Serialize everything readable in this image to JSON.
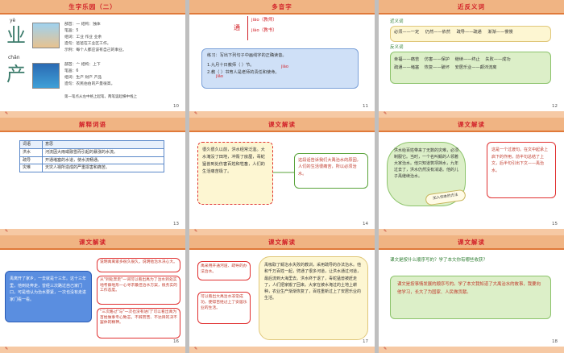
{
  "slides": [
    {
      "page": "10",
      "title": "生字乐园（二）",
      "char1": {
        "pinyin": "yè",
        "char": "业"
      },
      "char2": {
        "pinyin": "chǎn",
        "char": "产"
      },
      "lines": [
        "部首：一  结构：独体",
        "笔画：5",
        "组词：工业  作业  业余",
        "造句：爸爸在工业区工作。",
        "示例：每个人都应该有自己的事业。"
      ],
      "lines2": [
        "部首：亠  结构：上下",
        "笔画：6",
        "组词：生产  财产  产品",
        "造句：农民伯伯的产量很高。"
      ],
      "note": "第一笔点从左中格上起笔，两笔竖起横中线上"
    },
    {
      "page": "11",
      "title": "多音字",
      "hanzi": "通",
      "readings": [
        "jiāo（教师）",
        "jiào（教书）"
      ],
      "task": "练习：写出下列句子中画线字的正确读音。",
      "q1": "1.九月十日教师（   ）节。",
      "q2": "2.教（     ）书育人是老师的责任和使命。",
      "ans1": "jiào",
      "ans2": "jiāo"
    },
    {
      "page": "12",
      "title": "近反义词",
      "syn_label": "近义词",
      "syn": [
        "必须——一定",
        "仍然——依然",
        "疏导——疏通",
        "渐渐——慢慢"
      ],
      "ant_label": "反义词",
      "ant": [
        "幸福——痛苦",
        "仿害——保护",
        "继续——终止",
        "失败——成功",
        "疏通——堵塞",
        "恢复——破坏",
        "安居乐业——颠沛流离"
      ]
    },
    {
      "page": "13",
      "title": "解释词语",
      "head": [
        "词语",
        "意思"
      ],
      "rows": [
        [
          "洪水",
          "河流因大雨或融雪而引起的暴涨的水流。"
        ],
        [
          "疏导",
          "开通堵塞的水道，使水流畅通。"
        ],
        [
          "灾难",
          "天灾人祸所造成的严重损害和痛苦。"
        ]
      ]
    },
    {
      "page": "14",
      "title": "课文解读",
      "passage": "很久很久以前，洪水经常泛滥。大水淹没了田地，冲毁了房屋，毒蛇猛兽到处伤害百姓和牲畜，人们的生活痛苦极了。",
      "comment": "这段话告诉我们大禹治水的原因，人们的生活很痛苦，所以必须治水。"
    },
    {
      "page": "15",
      "title": "课文解读",
      "passage": "洪水给百姓带来了无数的灾难，必须制服它。当时，一个名叫鲧的人领着大家治水。他只知道筑坝挡水，九年过去了，洪水仍然没有消退。他的儿子禹继续治水。",
      "note": "这是一个过渡句。在文中起承上启下的作用，前半句总结了上文，后半句引出下文——禹治水。",
      "tag": "加入你本的方法"
    },
    {
      "page": "16",
      "title": "课文解读",
      "passage": "禹离开了家乡，一去就是十三年。这十三年里，他到处奔走，曾经三次路过自己家门口，可是他认为治水要紧，一次也没有走进家门看一看。",
      "note1": "说明禹离家多很久很久，说明他治水决心大。",
      "note2": "从\"到处奔走\"一词可以看出禹为了治水到处实地考察地形一心寻求最佳治水方案，很务实的工作态度。",
      "note3": "\"三次路过\"与\"一次也没有进门\"可以看出禹为百姓做事专心致志，不辞劳苦、不达目的决不罢休的精神。"
    },
    {
      "page": "17",
      "title": "课文解读",
      "passage": "禹吸取了鲧治水失败的教训，采用疏导的办法治水。他和千万百姓一起，劈通了很多河道，让洪水通过河道，最后流到大海里去。洪水终于退了，毒蛇猛兽被赶走了，人们把家搬了回来。大家在被水淹过的土地上耕种，农业生产渐渐恢复了，百姓重新过上了安居乐业的生活。",
      "note1": "禹采用开通河道、疏导的办法治水。",
      "note2": "可以看出大禹治水非常成功，使得百姓过上了安居乐业的生活。"
    },
    {
      "page": "18",
      "title": "课文解读",
      "question": "课文是按什么顺序写的？学了本文你有哪些收获？",
      "answer": "课文是按事情发展的顺序写的。学了本文我知道了大禹治水的故事，我要向他学习，长大了为国家、人民做贡献。"
    }
  ],
  "colors": {
    "header_bg": "#f0b483",
    "header_title": "#d2232a",
    "box_blue": "#cfe0f7",
    "box_green": "#dcefc8",
    "box_yellow": "#fdf6d2",
    "border_red": "#e03030",
    "border_green": "#5aa33a"
  }
}
